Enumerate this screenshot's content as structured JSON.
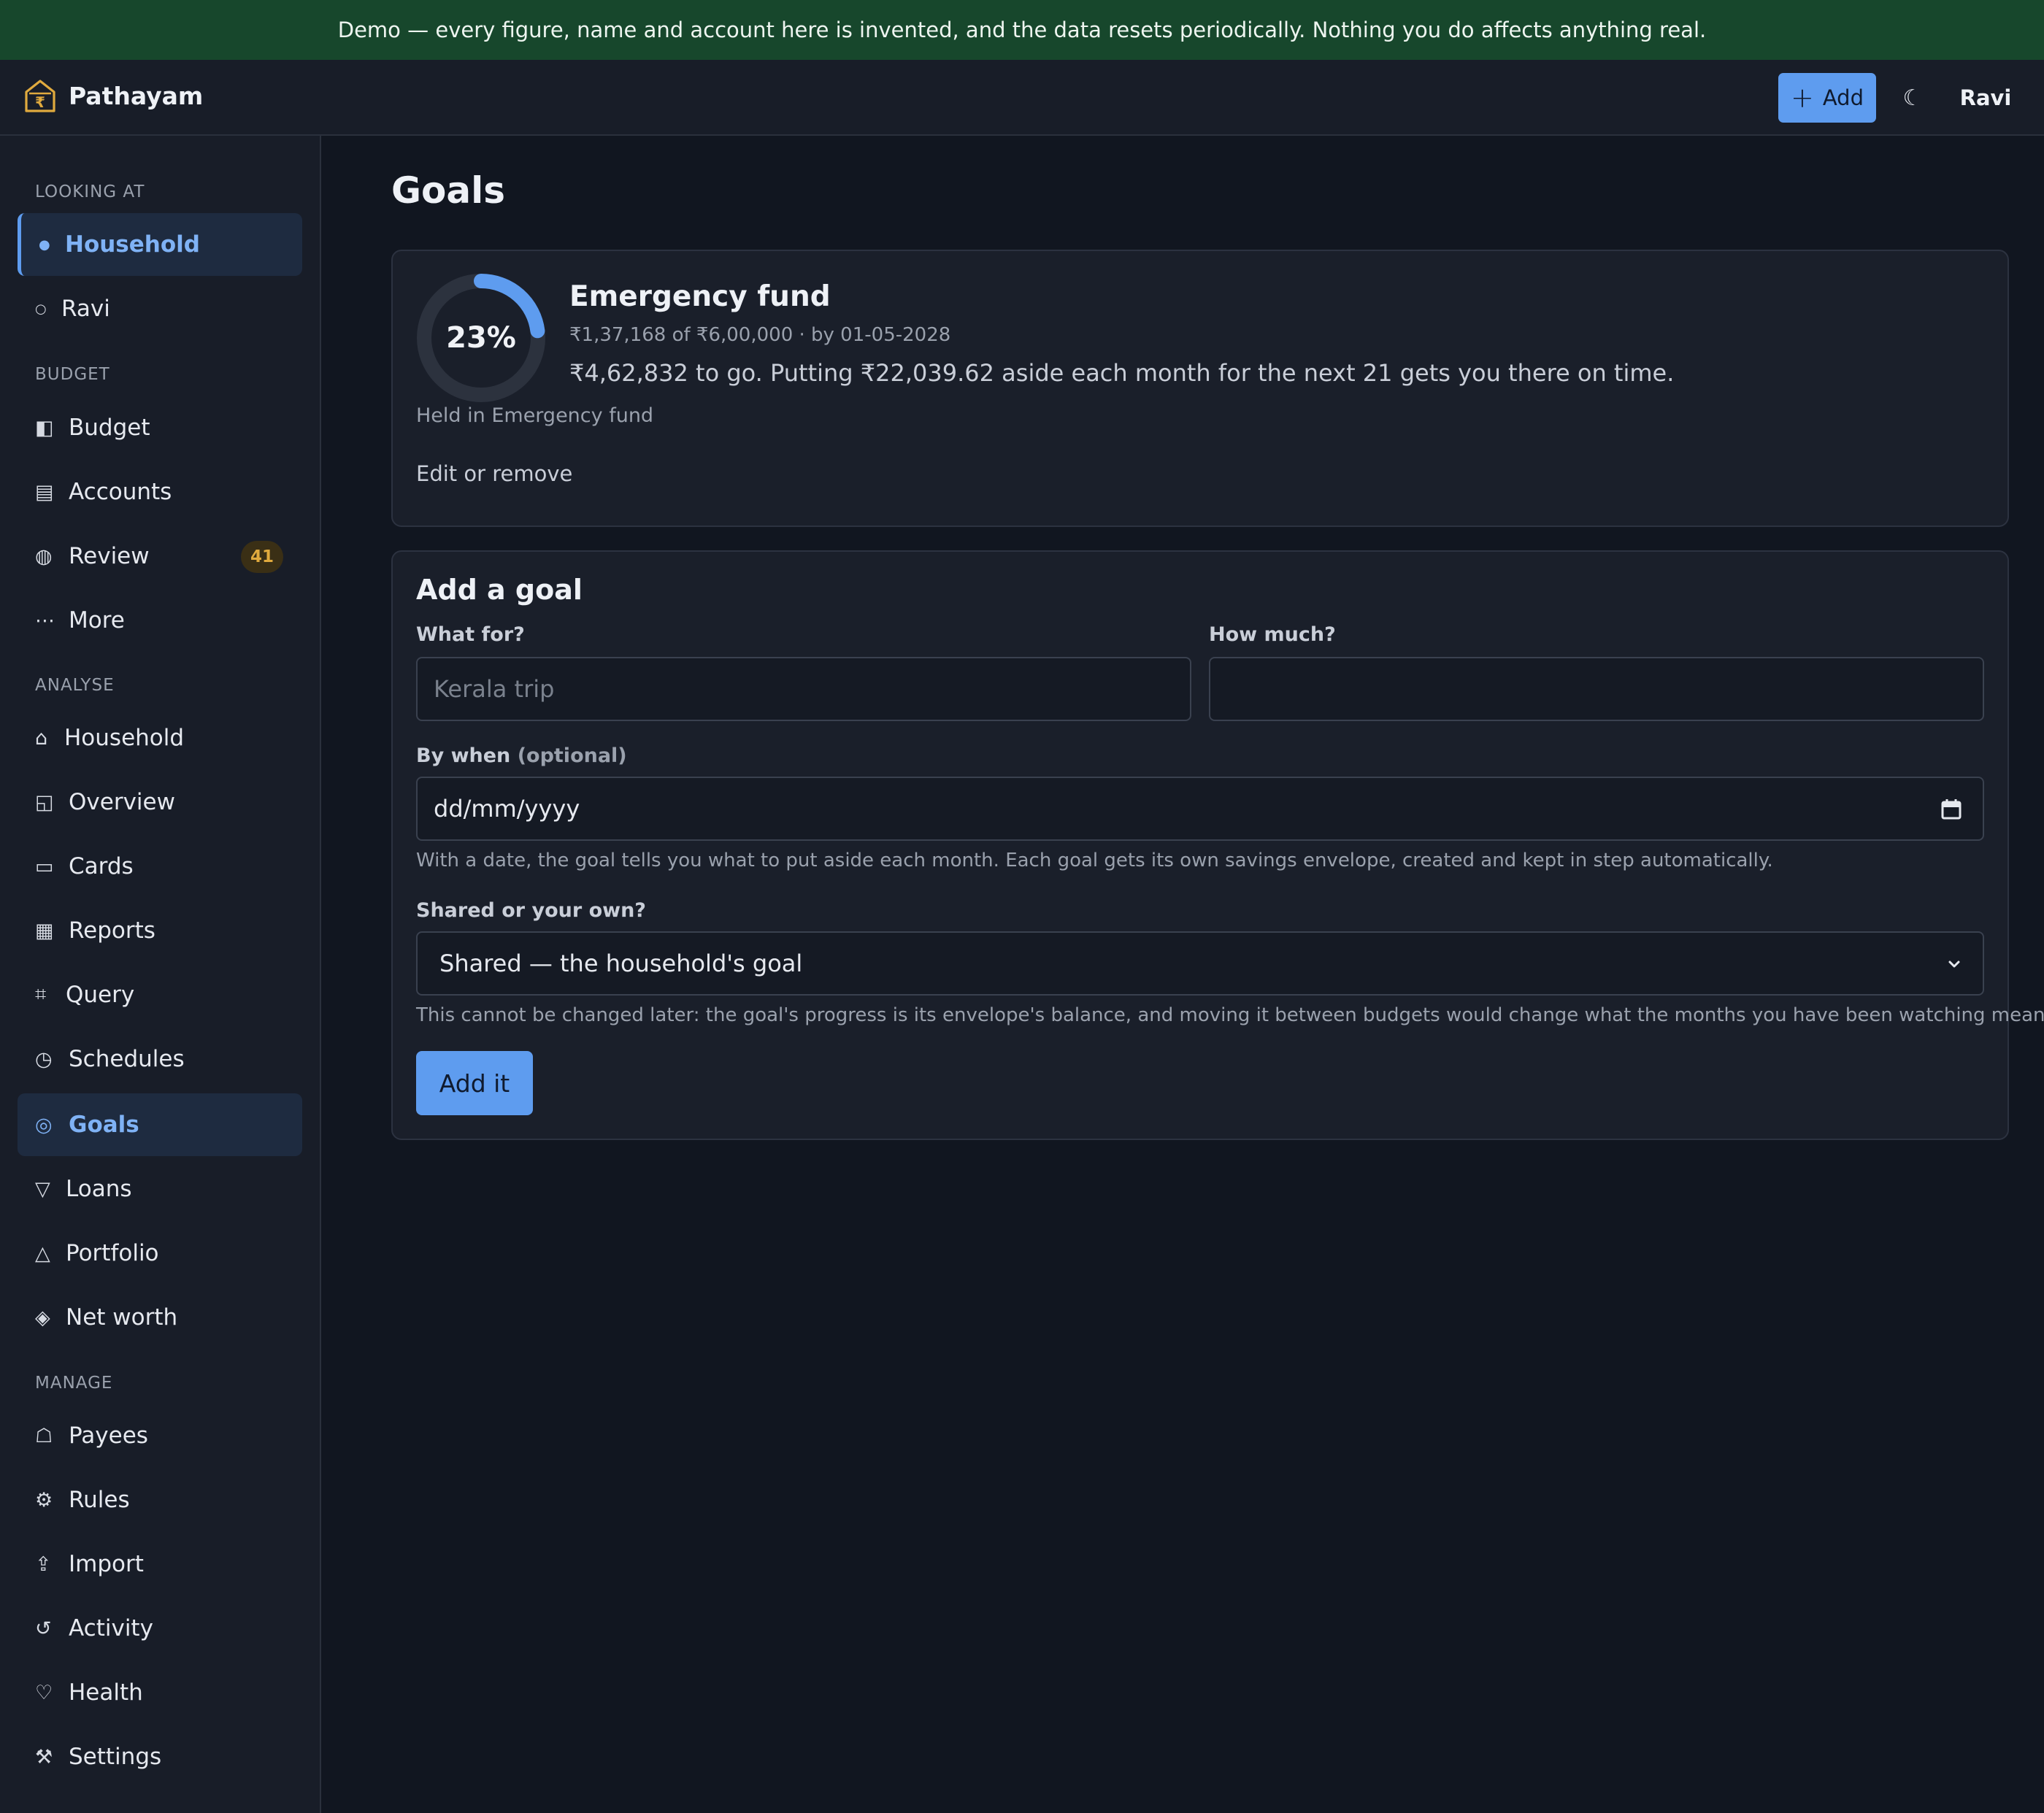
{
  "banner": {
    "text": "Demo — every figure, name and account here is invented, and the data resets periodically. Nothing you do affects anything real."
  },
  "topbar": {
    "app_name": "Pathayam",
    "add_label": "Add",
    "theme_icon": "moon-icon",
    "user_name": "Ravi"
  },
  "sidebar": {
    "looking_at": {
      "heading": "LOOKING AT",
      "items": [
        {
          "label": "Household",
          "icon": "●",
          "active": true
        },
        {
          "label": "Ravi",
          "icon": "○"
        }
      ]
    },
    "budget": {
      "heading": "BUDGET",
      "items": [
        {
          "label": "Budget",
          "icon": "◧"
        },
        {
          "label": "Accounts",
          "icon": "▤"
        },
        {
          "label": "Review",
          "icon": "◍",
          "badge": "41"
        },
        {
          "label": "More",
          "icon": "⋯"
        }
      ]
    },
    "analyse": {
      "heading": "ANALYSE",
      "items": [
        {
          "label": "Household",
          "icon": "⌂"
        },
        {
          "label": "Overview",
          "icon": "◱"
        },
        {
          "label": "Cards",
          "icon": "▭"
        },
        {
          "label": "Reports",
          "icon": "▦"
        },
        {
          "label": "Query",
          "icon": "⌗"
        },
        {
          "label": "Schedules",
          "icon": "◷"
        },
        {
          "label": "Goals",
          "icon": "◎",
          "active": true
        },
        {
          "label": "Loans",
          "icon": "▽"
        },
        {
          "label": "Portfolio",
          "icon": "△"
        },
        {
          "label": "Net worth",
          "icon": "◈"
        }
      ]
    },
    "manage": {
      "heading": "MANAGE",
      "items": [
        {
          "label": "Payees",
          "icon": "☖"
        },
        {
          "label": "Rules",
          "icon": "⚙"
        },
        {
          "label": "Import",
          "icon": "⇪"
        },
        {
          "label": "Activity",
          "icon": "↺"
        },
        {
          "label": "Health",
          "icon": "♡"
        },
        {
          "label": "Settings",
          "icon": "⚒"
        }
      ]
    }
  },
  "main": {
    "title": "Goals",
    "goal": {
      "name": "Emergency fund",
      "progress": 0.23,
      "progress_label": "23%",
      "meta": "₹1,37,168 of ₹6,00,000 · by 01-05-2028",
      "plan": "₹4,62,832 to go. Putting ₹22,039.62 aside each month for the next 21 gets you there on time.",
      "held_in": "Held in Emergency fund",
      "edit_link": "Edit or remove",
      "ring_color": "#5e9cef"
    },
    "form": {
      "title": "Add a goal",
      "what_label": "What for?",
      "what_placeholder": "Kerala trip",
      "what_value": "",
      "how_much_label": "How much?",
      "how_much_value": "",
      "when_label": "By when",
      "when_optional": "(optional)",
      "when_placeholder": "dd/mm/yyyy",
      "when_help": "With a date, the goal tells you what to put aside each month. Each goal gets its own savings envelope, created and kept in step automatically.",
      "shared_label": "Shared or your own?",
      "shared_value": "Shared — the household's goal",
      "shared_help": "This cannot be changed later: the goal's progress is its envelope's balance, and moving it between budgets would change what the months you have been watching meant.",
      "submit_label": "Add it"
    }
  }
}
